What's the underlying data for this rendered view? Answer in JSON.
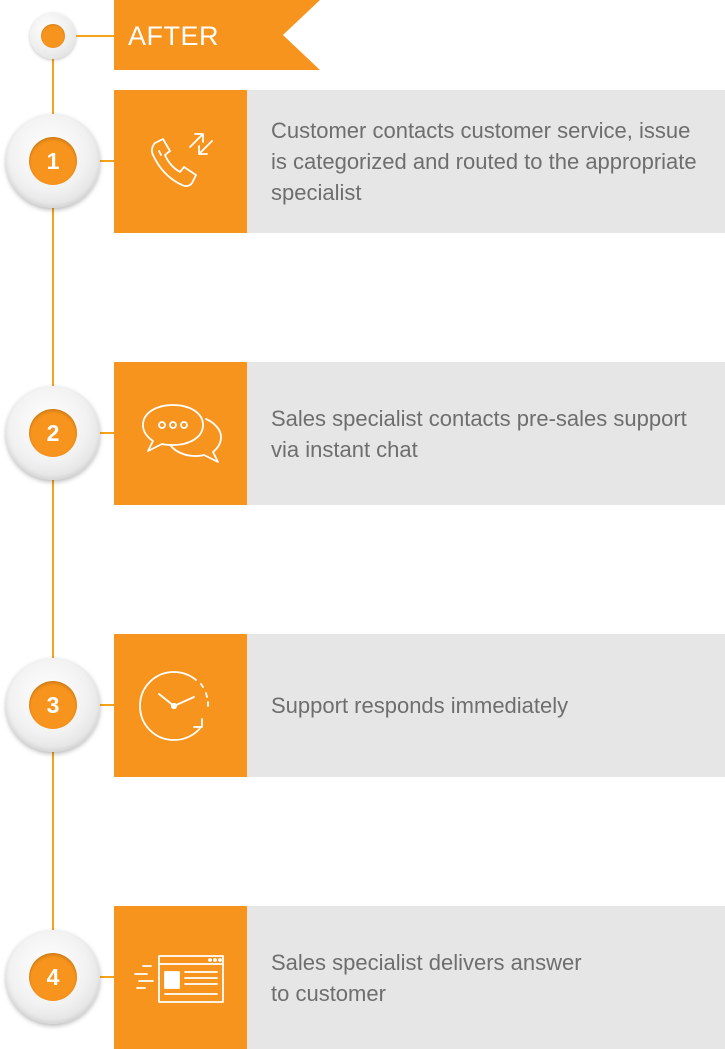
{
  "header": {
    "label": "AFTER"
  },
  "steps": [
    {
      "number": "1",
      "icon": "phone-transfer-icon",
      "text": "Customer contacts customer service, issue is categorized and routed to the appropriate specialist"
    },
    {
      "number": "2",
      "icon": "chat-bubbles-icon",
      "text": "Sales specialist contacts pre-sales support via instant chat"
    },
    {
      "number": "3",
      "icon": "clock-refresh-icon",
      "text": "Support responds immediately"
    },
    {
      "number": "4",
      "icon": "fast-message-window-icon",
      "text": "Sales specialist delivers answer to customer"
    }
  ],
  "colors": {
    "accent": "#f7941d",
    "panel": "#e6e6e6",
    "text": "#6e6e6e"
  }
}
